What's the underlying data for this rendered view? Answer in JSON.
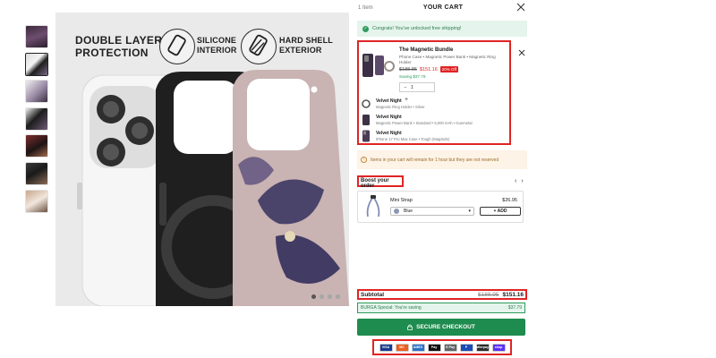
{
  "thumbnails": [
    {
      "alt": "case-front"
    },
    {
      "alt": "layers"
    },
    {
      "alt": "case-angle"
    },
    {
      "alt": "case-side"
    },
    {
      "alt": "lifestyle-1"
    },
    {
      "alt": "lifestyle-2"
    },
    {
      "alt": "lifestyle-3"
    }
  ],
  "hero": {
    "title_line1": "DOUBLE LAYER",
    "title_line2": "PROTECTION",
    "silicone_line1": "SILICONE",
    "silicone_line2": "INTERIOR",
    "hard_line1": "HARD SHELL",
    "hard_line2": "EXTERIOR"
  },
  "cart": {
    "item_count": "1 Item",
    "title": "YOUR CART",
    "free_shipping": "Congrats! You've unlocked free shipping!",
    "bundle": {
      "name": "The Magnetic Bundle",
      "desc": "Phone Case • Magnetic Power Bank • Magnetic Ring Holder",
      "old_price": "$188.85",
      "new_price": "$151.16",
      "badge": "20% Off",
      "saving": "Saving $37.79",
      "qty": "1",
      "items": [
        {
          "name": "Velvet Night",
          "desc": "Magnetic Ring Holder • Silver"
        },
        {
          "name": "Velvet Night",
          "desc": "Magnetic Power Bank • Standard • 5,000 mAh • Gunmetal"
        },
        {
          "name": "Velvet Night",
          "desc": "iPhone 17 Pro Max Case • Tough (MagSafe)"
        }
      ]
    },
    "reserve_note": "Items in your cart will remain for 1 hour but they are not reserved",
    "boost_title": "Boost your order",
    "upsell": {
      "name": "Mini Strap",
      "price": "$26.95",
      "color": "Blue",
      "add_label": "+ ADD"
    },
    "subtotal_label": "Subtotal",
    "subtotal_old": "$188.95",
    "subtotal_new": "$151.16",
    "special_label": "BURGA Special: You're saving",
    "special_value": "$37.79",
    "checkout_label": "SECURE CHECKOUT",
    "payments": [
      {
        "name": "VISA",
        "color": "#1a3b8f"
      },
      {
        "name": "MC",
        "color": "#eb5e20"
      },
      {
        "name": "AMEX",
        "color": "#2a72c8"
      },
      {
        "name": "Pay",
        "color": "#111111"
      },
      {
        "name": "G Pay",
        "color": "#5f6368"
      },
      {
        "name": "P",
        "color": "#1b4bb5"
      },
      {
        "name": "afterpay",
        "color": "#2b2b2b"
      },
      {
        "name": "shop",
        "color": "#5a31f4"
      }
    ]
  }
}
